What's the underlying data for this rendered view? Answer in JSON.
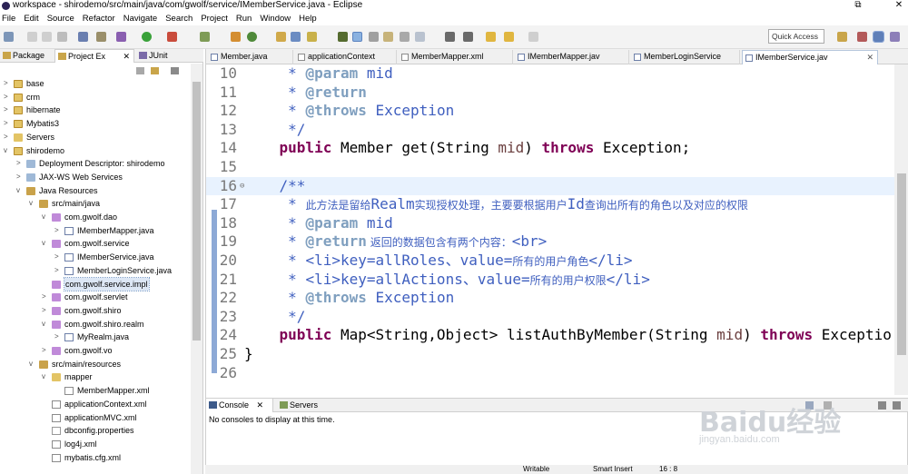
{
  "window": {
    "title": "workspace - shirodemo/src/main/java/com/gwolf/service/IMemberService.java - Eclipse",
    "restore_glyph": "⧉",
    "close_glyph": "✕"
  },
  "menu": [
    "File",
    "Edit",
    "Source",
    "Refactor",
    "Navigate",
    "Search",
    "Project",
    "Run",
    "Window",
    "Help"
  ],
  "toolbar": {
    "quick_access": "Quick Access"
  },
  "left_tabs": [
    {
      "label": "Package"
    },
    {
      "label": "Project Ex",
      "close": "✕"
    },
    {
      "label": "JUnit"
    }
  ],
  "tree": [
    {
      "label": "base",
      "depth": 0,
      "arrow": ">",
      "icon": "proj"
    },
    {
      "label": "crm",
      "depth": 0,
      "arrow": ">",
      "icon": "proj"
    },
    {
      "label": "hibernate",
      "depth": 0,
      "arrow": ">",
      "icon": "proj"
    },
    {
      "label": "Mybatis3",
      "depth": 0,
      "arrow": ">",
      "icon": "proj"
    },
    {
      "label": "Servers",
      "depth": 0,
      "arrow": ">",
      "icon": "folder"
    },
    {
      "label": "shirodemo",
      "depth": 0,
      "arrow": "v",
      "icon": "proj"
    },
    {
      "label": "Deployment Descriptor: shirodemo",
      "depth": 1,
      "arrow": ">",
      "icon": "jar"
    },
    {
      "label": "JAX-WS Web Services",
      "depth": 1,
      "arrow": ">",
      "icon": "jar"
    },
    {
      "label": "Java Resources",
      "depth": 1,
      "arrow": "v",
      "icon": "src"
    },
    {
      "label": "src/main/java",
      "depth": 2,
      "arrow": "v",
      "icon": "src"
    },
    {
      "label": "com.gwolf.dao",
      "depth": 3,
      "arrow": "v",
      "icon": "pkg"
    },
    {
      "label": "IMemberMapper.java",
      "depth": 4,
      "arrow": ">",
      "icon": "java"
    },
    {
      "label": "com.gwolf.service",
      "depth": 3,
      "arrow": "v",
      "icon": "pkg"
    },
    {
      "label": "IMemberService.java",
      "depth": 4,
      "arrow": ">",
      "icon": "java"
    },
    {
      "label": "MemberLoginService.java",
      "depth": 4,
      "arrow": ">",
      "icon": "java"
    },
    {
      "label": "com.gwolf.service.impl",
      "depth": 3,
      "arrow": "",
      "icon": "pkg",
      "selected": true
    },
    {
      "label": "com.gwolf.servlet",
      "depth": 3,
      "arrow": ">",
      "icon": "pkg"
    },
    {
      "label": "com.gwolf.shiro",
      "depth": 3,
      "arrow": ">",
      "icon": "pkg"
    },
    {
      "label": "com.gwolf.shiro.realm",
      "depth": 3,
      "arrow": "v",
      "icon": "pkg"
    },
    {
      "label": "MyRealm.java",
      "depth": 4,
      "arrow": ">",
      "icon": "java"
    },
    {
      "label": "com.gwolf.vo",
      "depth": 3,
      "arrow": ">",
      "icon": "pkg"
    },
    {
      "label": "src/main/resources",
      "depth": 2,
      "arrow": "v",
      "icon": "src"
    },
    {
      "label": "mapper",
      "depth": 3,
      "arrow": "v",
      "icon": "folder"
    },
    {
      "label": "MemberMapper.xml",
      "depth": 4,
      "arrow": "",
      "icon": "xml"
    },
    {
      "label": "applicationContext.xml",
      "depth": 3,
      "arrow": "",
      "icon": "xml"
    },
    {
      "label": "applicationMVC.xml",
      "depth": 3,
      "arrow": "",
      "icon": "xml"
    },
    {
      "label": "dbconfig.properties",
      "depth": 3,
      "arrow": "",
      "icon": "props"
    },
    {
      "label": "log4j.xml",
      "depth": 3,
      "arrow": "",
      "icon": "xml"
    },
    {
      "label": "mybatis.cfg.xml",
      "depth": 3,
      "arrow": "",
      "icon": "xml"
    }
  ],
  "editor_tabs": [
    {
      "label": "Member.java",
      "icon": "java"
    },
    {
      "label": "applicationContext",
      "icon": "xml"
    },
    {
      "label": "MemberMapper.xml",
      "icon": "xml"
    },
    {
      "label": "IMemberMapper.jav",
      "icon": "java"
    },
    {
      "label": "MemberLoginService",
      "icon": "java"
    },
    {
      "label": "IMemberService.jav",
      "icon": "java",
      "active": true,
      "close": "✕"
    }
  ],
  "code_lines": [
    {
      "n": "10",
      "parts": [
        [
          "t",
          "     "
        ],
        [
          "cm",
          "* "
        ],
        [
          "tag",
          "@param"
        ],
        [
          "cm",
          " mid"
        ]
      ]
    },
    {
      "n": "11",
      "parts": [
        [
          "t",
          "     "
        ],
        [
          "cm",
          "* "
        ],
        [
          "tag",
          "@return"
        ]
      ]
    },
    {
      "n": "12",
      "parts": [
        [
          "t",
          "     "
        ],
        [
          "cm",
          "* "
        ],
        [
          "tag",
          "@throws"
        ],
        [
          "cm",
          " Exception"
        ]
      ]
    },
    {
      "n": "13",
      "parts": [
        [
          "t",
          "     "
        ],
        [
          "cm",
          "*/"
        ]
      ]
    },
    {
      "n": "14",
      "parts": [
        [
          "t",
          "    "
        ],
        [
          "kw",
          "public"
        ],
        [
          "t",
          " Member get(String "
        ],
        [
          "var",
          "mid"
        ],
        [
          "t",
          ") "
        ],
        [
          "kw",
          "throws"
        ],
        [
          "t",
          " Exception;"
        ]
      ]
    },
    {
      "n": "15",
      "parts": []
    },
    {
      "n": "16",
      "marker": "⊖",
      "cur": true,
      "parts": [
        [
          "t",
          "    "
        ],
        [
          "cm",
          "/**"
        ]
      ]
    },
    {
      "n": "17",
      "parts": [
        [
          "t",
          "     "
        ],
        [
          "cm",
          "* "
        ],
        [
          "cjk",
          "此方法是留给"
        ],
        [
          "cm",
          "Realm"
        ],
        [
          "cjk",
          "实现授权处理，主要要根据用户"
        ],
        [
          "cm",
          "Id"
        ],
        [
          "cjk",
          "查询出所有的角色以及对应的权限"
        ]
      ]
    },
    {
      "n": "18",
      "parts": [
        [
          "t",
          "     "
        ],
        [
          "cm",
          "* "
        ],
        [
          "tag",
          "@param"
        ],
        [
          "cm",
          " mid"
        ]
      ]
    },
    {
      "n": "19",
      "parts": [
        [
          "t",
          "     "
        ],
        [
          "cm",
          "* "
        ],
        [
          "tag",
          "@return"
        ],
        [
          "cjk",
          " 返回的数据包含有两个内容："
        ],
        [
          "cm",
          "<br>"
        ]
      ]
    },
    {
      "n": "20",
      "parts": [
        [
          "t",
          "     "
        ],
        [
          "cm",
          "* <li>key=allRoles、value="
        ],
        [
          "cjk",
          "所有的用户角色"
        ],
        [
          "cm",
          "</li>"
        ]
      ]
    },
    {
      "n": "21",
      "parts": [
        [
          "t",
          "     "
        ],
        [
          "cm",
          "* <li>key=allActions、value="
        ],
        [
          "cjk",
          "所有的用户权限"
        ],
        [
          "cm",
          "</li>"
        ]
      ]
    },
    {
      "n": "22",
      "parts": [
        [
          "t",
          "     "
        ],
        [
          "cm",
          "* "
        ],
        [
          "tag",
          "@throws"
        ],
        [
          "cm",
          " Exception"
        ]
      ]
    },
    {
      "n": "23",
      "parts": [
        [
          "t",
          "     "
        ],
        [
          "cm",
          "*/"
        ]
      ]
    },
    {
      "n": "24",
      "parts": [
        [
          "t",
          "    "
        ],
        [
          "kw",
          "public"
        ],
        [
          "t",
          " Map<String,Object> listAuthByMember(String "
        ],
        [
          "var",
          "mid"
        ],
        [
          "t",
          ") "
        ],
        [
          "kw",
          "throws"
        ],
        [
          "t",
          " Exceptio"
        ]
      ]
    },
    {
      "n": "25",
      "parts": [
        [
          "t",
          "}"
        ]
      ]
    },
    {
      "n": "26",
      "parts": []
    }
  ],
  "console": {
    "tabs": [
      {
        "label": "Console",
        "close": "✕",
        "active": true
      },
      {
        "label": "Servers"
      }
    ],
    "message": "No consoles to display at this time."
  },
  "status": {
    "mode": "Writable",
    "insert": "Smart Insert",
    "position": "16 : 8"
  },
  "watermark": {
    "brand": "Baidu经验",
    "url": "jingyan.baidu.com"
  },
  "colors": {
    "keyword": "#7f0055",
    "comment": "#3f5fbf",
    "javadoc_tag": "#7f9fbf",
    "current_line": "#e8f2fe"
  }
}
